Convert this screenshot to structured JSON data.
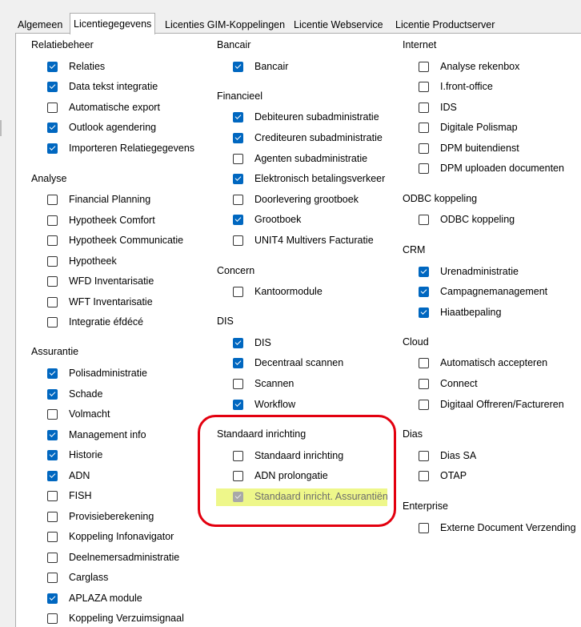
{
  "tabs": [
    {
      "label": "Algemeen",
      "active": false
    },
    {
      "label": "Licentiegegevens",
      "active": true
    },
    {
      "label": "Licenties GIM-Koppelingen",
      "active": false
    },
    {
      "label": "Licentie Webservice",
      "active": false
    },
    {
      "label": "Licentie Productserver",
      "active": false
    }
  ],
  "groups": {
    "relatiebeheer": {
      "title": "Relatiebeheer",
      "items": [
        {
          "label": "Relaties",
          "checked": true
        },
        {
          "label": "Data tekst integratie",
          "checked": true
        },
        {
          "label": "Automatische export",
          "checked": false
        },
        {
          "label": "Outlook agendering",
          "checked": true
        },
        {
          "label": "Importeren Relatiegegevens",
          "checked": true
        }
      ]
    },
    "analyse": {
      "title": "Analyse",
      "items": [
        {
          "label": "Financial Planning",
          "checked": false
        },
        {
          "label": "Hypotheek Comfort",
          "checked": false
        },
        {
          "label": "Hypotheek Communicatie",
          "checked": false
        },
        {
          "label": "Hypotheek",
          "checked": false
        },
        {
          "label": "WFD Inventarisatie",
          "checked": false
        },
        {
          "label": "WFT Inventarisatie",
          "checked": false
        },
        {
          "label": "Integratie éfdécé",
          "checked": false
        }
      ]
    },
    "assurantie": {
      "title": "Assurantie",
      "items": [
        {
          "label": "Polisadministratie",
          "checked": true
        },
        {
          "label": "Schade",
          "checked": true
        },
        {
          "label": "Volmacht",
          "checked": false
        },
        {
          "label": "Management info",
          "checked": true
        },
        {
          "label": "Historie",
          "checked": true
        },
        {
          "label": "ADN",
          "checked": true
        },
        {
          "label": "FISH",
          "checked": false
        },
        {
          "label": "Provisieberekening",
          "checked": false
        },
        {
          "label": "Koppeling Infonavigator",
          "checked": false
        },
        {
          "label": "Deelnemersadministratie",
          "checked": false
        },
        {
          "label": "Carglass",
          "checked": false
        },
        {
          "label": "APLAZA module",
          "checked": true
        },
        {
          "label": "Koppeling Verzuimsignaal",
          "checked": false
        }
      ]
    },
    "bancair": {
      "title": "Bancair",
      "items": [
        {
          "label": "Bancair",
          "checked": true
        }
      ]
    },
    "financieel": {
      "title": "Financieel",
      "items": [
        {
          "label": "Debiteuren subadministratie",
          "checked": true
        },
        {
          "label": "Crediteuren subadministratie",
          "checked": true
        },
        {
          "label": "Agenten subadministratie",
          "checked": false
        },
        {
          "label": "Elektronisch betalingsverkeer",
          "checked": true
        },
        {
          "label": "Doorlevering grootboek",
          "checked": false
        },
        {
          "label": "Grootboek",
          "checked": true
        },
        {
          "label": "UNIT4 Multivers Facturatie",
          "checked": false
        }
      ]
    },
    "concern": {
      "title": "Concern",
      "items": [
        {
          "label": "Kantoormodule",
          "checked": false
        }
      ]
    },
    "dis": {
      "title": "DIS",
      "items": [
        {
          "label": "DIS",
          "checked": true
        },
        {
          "label": "Decentraal scannen",
          "checked": true
        },
        {
          "label": "Scannen",
          "checked": false
        },
        {
          "label": "Workflow",
          "checked": true
        }
      ]
    },
    "standaard": {
      "title": "Standaard inrichting",
      "items": [
        {
          "label": "Standaard inrichting",
          "checked": false
        },
        {
          "label": "ADN prolongatie",
          "checked": false
        },
        {
          "label": "Standaard inricht. Assurantiën",
          "checked": true,
          "disabled": true
        }
      ]
    },
    "internet": {
      "title": "Internet",
      "items": [
        {
          "label": "Analyse rekenbox",
          "checked": false
        },
        {
          "label": "I.front-office",
          "checked": false
        },
        {
          "label": "IDS",
          "checked": false
        },
        {
          "label": "Digitale Polismap",
          "checked": false
        },
        {
          "label": "DPM buitendienst",
          "checked": false
        },
        {
          "label": "DPM uploaden documenten",
          "checked": false
        }
      ]
    },
    "odbc": {
      "title": "ODBC koppeling",
      "items": [
        {
          "label": "ODBC koppeling",
          "checked": false
        }
      ]
    },
    "crm": {
      "title": "CRM",
      "items": [
        {
          "label": "Urenadministratie",
          "checked": true
        },
        {
          "label": "Campagnemanagement",
          "checked": true
        },
        {
          "label": "Hiaatbepaling",
          "checked": true
        }
      ]
    },
    "cloud": {
      "title": "Cloud",
      "items": [
        {
          "label": "Automatisch accepteren",
          "checked": false
        },
        {
          "label": "Connect",
          "checked": false
        },
        {
          "label": "Digitaal Offreren/Factureren",
          "checked": false
        }
      ]
    },
    "dias": {
      "title": "Dias",
      "items": [
        {
          "label": "Dias SA",
          "checked": false
        },
        {
          "label": "OTAP",
          "checked": false
        }
      ]
    },
    "enterprise": {
      "title": "Enterprise",
      "items": [
        {
          "label": "Externe Document Verzending",
          "checked": false
        }
      ]
    }
  },
  "colors": {
    "checkbox_checked": "#0067c0",
    "annotation_box": "#e3000f",
    "highlight": "#eef78a"
  }
}
